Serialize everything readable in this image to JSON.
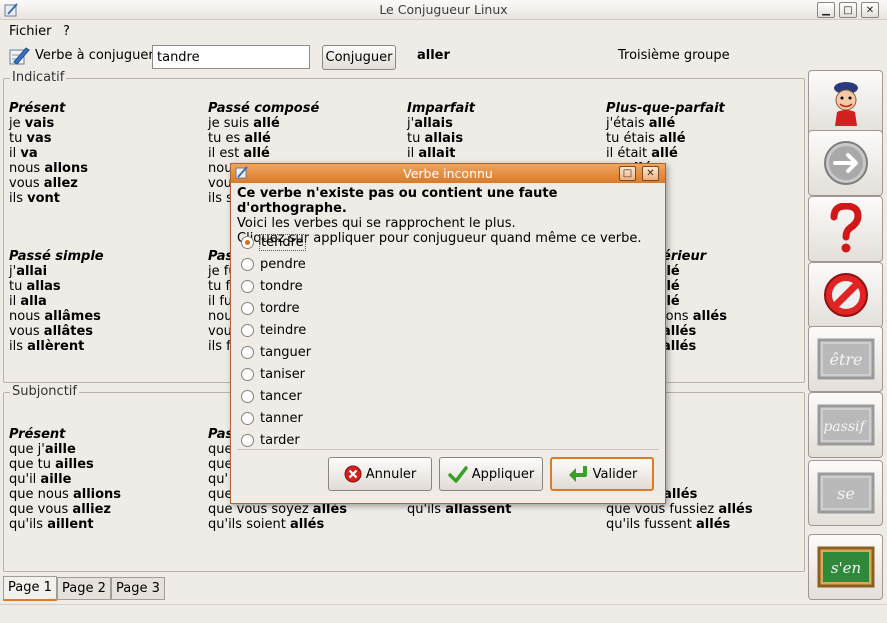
{
  "window": {
    "title": "Le Conjugueur Linux"
  },
  "menu": {
    "fichier": "Fichier",
    "help": "?"
  },
  "toolbar": {
    "verb_label": "Verbe à conjuguer",
    "verb_value": "tandre",
    "conjugate_button": "Conjuguer",
    "infinitive": "aller",
    "group": "Troisième groupe"
  },
  "indicatif": {
    "title": "Indicatif",
    "present": {
      "name": "Présent",
      "rows": [
        [
          "je ",
          "vais"
        ],
        [
          "tu ",
          "vas"
        ],
        [
          "il ",
          "va"
        ],
        [
          "nous ",
          "allons"
        ],
        [
          "vous ",
          "allez"
        ],
        [
          "ils ",
          "vont"
        ]
      ]
    },
    "passe_compose": {
      "name": "Passé composé",
      "rows": [
        [
          "je suis ",
          "allé"
        ],
        [
          "tu es ",
          "allé"
        ],
        [
          "il est ",
          "allé"
        ],
        [
          "nou",
          ""
        ],
        [
          "vou",
          ""
        ],
        [
          "ils s",
          ""
        ]
      ]
    },
    "imparfait": {
      "name": "Imparfait",
      "rows": [
        [
          "j'",
          "allais"
        ],
        [
          "tu ",
          "allais"
        ],
        [
          "il ",
          "allait"
        ],
        [
          "",
          ""
        ],
        [
          "",
          ""
        ],
        [
          "",
          ""
        ]
      ]
    },
    "plus_que_parfait": {
      "name": "Plus-que-parfait",
      "rows": [
        [
          "j'étais ",
          "allé"
        ],
        [
          "tu étais ",
          "allé"
        ],
        [
          "il était ",
          "allé"
        ],
        [
          "ns ",
          "allés"
        ],
        [
          "",
          "allés"
        ],
        [
          "",
          "allés"
        ]
      ]
    },
    "passe_simple": {
      "name": "Passé simple",
      "rows": [
        [
          "j'",
          "allai"
        ],
        [
          "tu ",
          "allas"
        ],
        [
          "il ",
          "alla"
        ],
        [
          "nous ",
          "allâmes"
        ],
        [
          "vous ",
          "allâtes"
        ],
        [
          "ils ",
          "allèrent"
        ]
      ]
    },
    "passe_anterieur_partial": {
      "name": "Pas",
      "rows": [
        [
          "je fu",
          ""
        ],
        [
          "tu fu",
          ""
        ],
        [
          "il fu",
          ""
        ],
        [
          "nous",
          ""
        ],
        [
          "vou",
          ""
        ],
        [
          "ils fu",
          ""
        ]
      ]
    },
    "plus_anterieur_partial": {
      "name": "érieur",
      "rows": [
        [
          "",
          "llé"
        ],
        [
          "",
          "llé"
        ],
        [
          "",
          "llé"
        ],
        [
          "ions ",
          "allés"
        ],
        [
          "",
          "allés"
        ],
        [
          "",
          "allés"
        ]
      ]
    }
  },
  "subjonctif": {
    "title": "Subjonctif",
    "present": {
      "name": "Présent",
      "rows": [
        [
          "que j'",
          "aille"
        ],
        [
          "que tu ",
          "ailles"
        ],
        [
          "qu'il ",
          "aille"
        ],
        [
          "que nous ",
          "allions"
        ],
        [
          "que vous ",
          "alliez"
        ],
        [
          "qu'ils ",
          "aillent"
        ]
      ]
    },
    "passe_partial": {
      "name": "Pas",
      "rows": [
        [
          "que",
          ""
        ],
        [
          "que",
          ""
        ],
        [
          "qu'",
          ""
        ],
        [
          "que",
          ""
        ],
        [
          "que vous soyez ",
          "allés"
        ],
        [
          "qu'ils soient ",
          "allés"
        ]
      ]
    },
    "imparfait_partial": {
      "name": "",
      "rows": [
        [
          "",
          ""
        ],
        [
          "",
          ""
        ],
        [
          "",
          ""
        ],
        [
          "",
          ""
        ],
        [
          "que vous ",
          "allassiez"
        ],
        [
          "qu'ils ",
          "allassent"
        ]
      ]
    },
    "plus_que_parfait_partial": {
      "name": "-parfait",
      "rows": [
        [
          "sse ",
          "allé"
        ],
        [
          "sses ",
          "allé"
        ],
        [
          "",
          ""
        ],
        [
          "fussions ",
          "allés"
        ],
        [
          "que vous fussiez ",
          "allés"
        ],
        [
          "qu'ils fussent ",
          "allés"
        ]
      ]
    }
  },
  "tabs": [
    "Page 1",
    "Page 2",
    "Page 3"
  ],
  "dialog": {
    "title": "Verbe inconnu",
    "message_bold": "Ce verbe n'existe pas ou contient une faute d'orthographe.",
    "message_line2": "Voici les verbes qui se rapprochent le plus.",
    "message_line3": "Cliquez sur appliquer pour conjugueur quand même ce verbe.",
    "options": [
      "tendre",
      "pendre",
      "tondre",
      "tordre",
      "teindre",
      "tanguer",
      "taniser",
      "tancer",
      "tanner",
      "tarder"
    ],
    "selected": "tendre",
    "cancel": "Annuler",
    "apply": "Appliquer",
    "validate": "Valider"
  },
  "sidebar": {
    "etre": "être",
    "passif": "passif",
    "se": "se",
    "sen": "s'en"
  },
  "colors": {
    "accent": "#e07b24",
    "dialog_title": "#d97a2a"
  }
}
